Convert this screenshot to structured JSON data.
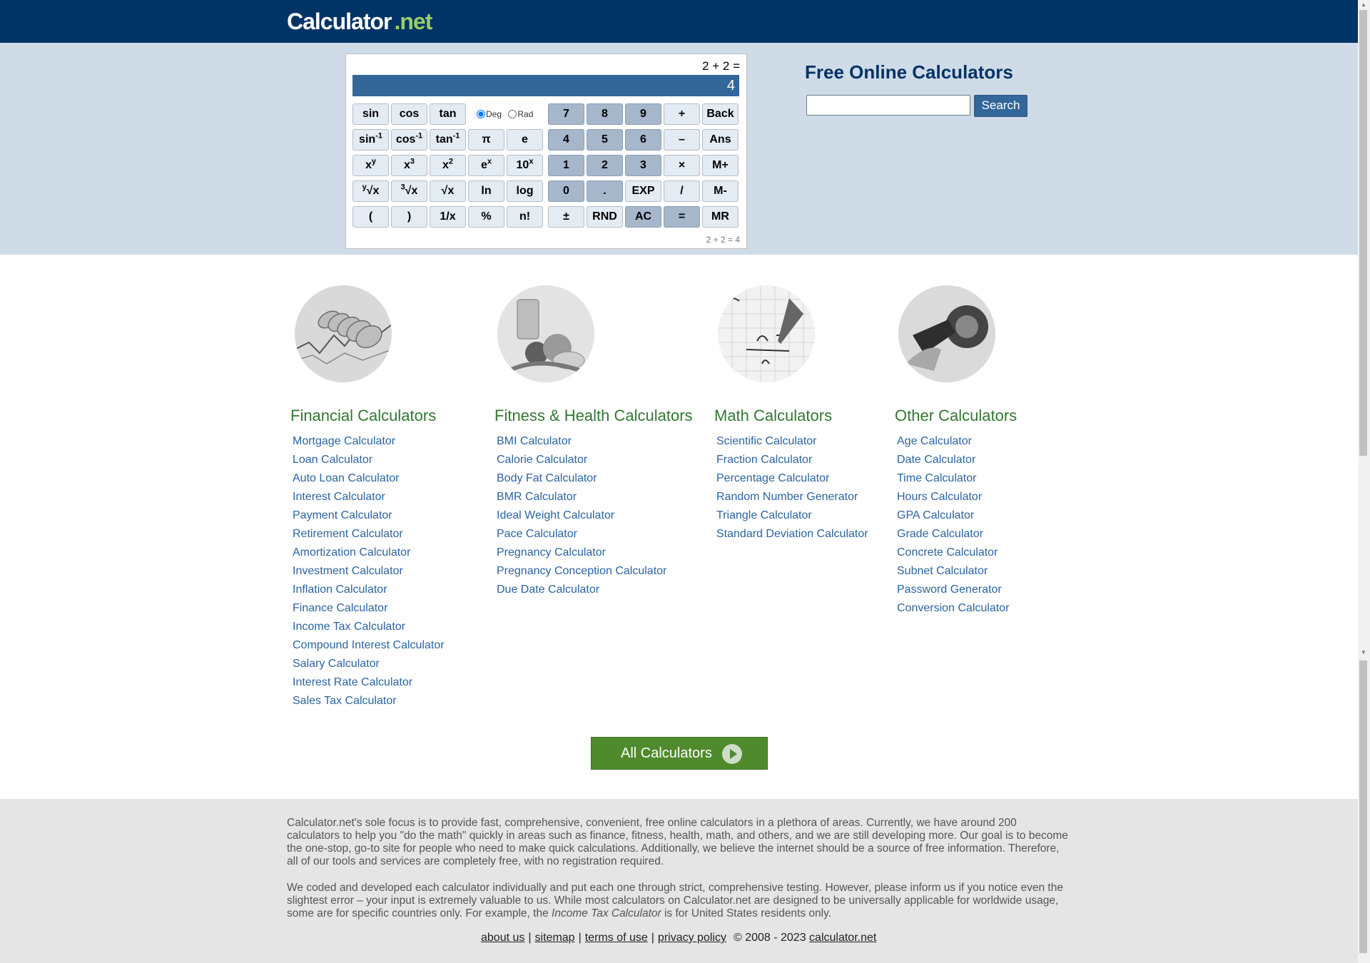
{
  "header": {
    "logo_main": "Calculator",
    "logo_tld": ".net"
  },
  "calculator": {
    "expression": "2 + 2 =",
    "display": "4",
    "footer_expression": "2 + 2 = 4",
    "angle_mode": {
      "deg": "Deg",
      "rad": "Rad",
      "selected": "Deg"
    },
    "keys": {
      "sin": "sin",
      "cos": "cos",
      "tan": "tan",
      "asin_base": "sin",
      "acos_base": "cos",
      "atan_base": "tan",
      "inverse_sup": "-1",
      "pi": "π",
      "e": "e",
      "xy_base": "x",
      "xy_sup": "y",
      "x3_base": "x",
      "x3_sup": "3",
      "x2_base": "x",
      "x2_sup": "2",
      "ex_base": "e",
      "ex_sup": "x",
      "tenx_base": "10",
      "tenx_sup": "x",
      "yroot_sup": "y",
      "yroot": "√x",
      "cuberoot_sup": "3",
      "cuberoot": "√x",
      "sqrt": "√x",
      "ln": "ln",
      "log": "log",
      "lparen": "(",
      "rparen": ")",
      "inv": "1/x",
      "percent": "%",
      "fact": "n!",
      "n7": "7",
      "n8": "8",
      "n9": "9",
      "plus": "+",
      "back": "Back",
      "n4": "4",
      "n5": "5",
      "n6": "6",
      "minus": "–",
      "ans": "Ans",
      "n1": "1",
      "n2": "2",
      "n3": "3",
      "times": "×",
      "mplus": "M+",
      "n0": "0",
      "dot": ".",
      "exp": "EXP",
      "divide": "/",
      "mminus": "M-",
      "plusminus": "±",
      "rnd": "RND",
      "ac": "AC",
      "equals": "=",
      "mr": "MR"
    }
  },
  "sidebar": {
    "title": "Free Online Calculators",
    "search_value": "",
    "search_button": "Search"
  },
  "categories": [
    {
      "title": "Financial Calculators",
      "icon": "coins-chart-image",
      "links": [
        "Mortgage Calculator",
        "Loan Calculator",
        "Auto Loan Calculator",
        "Interest Calculator",
        "Payment Calculator",
        "Retirement Calculator",
        "Amortization Calculator",
        "Investment Calculator",
        "Inflation Calculator",
        "Finance Calculator",
        "Income Tax Calculator",
        "Compound Interest Calculator",
        "Salary Calculator",
        "Interest Rate Calculator",
        "Sales Tax Calculator"
      ]
    },
    {
      "title": "Fitness & Health Calculators",
      "icon": "fruit-measuring-tape-image",
      "links": [
        "BMI Calculator",
        "Calorie Calculator",
        "Body Fat Calculator",
        "BMR Calculator",
        "Ideal Weight Calculator",
        "Pace Calculator",
        "Pregnancy Calculator",
        "Pregnancy Conception Calculator",
        "Due Date Calculator"
      ]
    },
    {
      "title": "Math Calculators",
      "icon": "math-formula-image",
      "links": [
        "Scientific Calculator",
        "Fraction Calculator",
        "Percentage Calculator",
        "Random Number Generator",
        "Triangle Calculator",
        "Standard Deviation Calculator"
      ]
    },
    {
      "title": "Other Calculators",
      "icon": "fuel-pump-image",
      "links": [
        "Age Calculator",
        "Date Calculator",
        "Time Calculator",
        "Hours Calculator",
        "GPA Calculator",
        "Grade Calculator",
        "Concrete Calculator",
        "Subnet Calculator",
        "Password Generator",
        "Conversion Calculator"
      ]
    }
  ],
  "all_calculators_button": "All Calculators",
  "footer": {
    "paragraph1": "Calculator.net's sole focus is to provide fast, comprehensive, convenient, free online calculators in a plethora of areas. Currently, we have around 200 calculators to help you \"do the math\" quickly in areas such as finance, fitness, health, math, and others, and we are still developing more. Our goal is to become the one-stop, go-to site for people who need to make quick calculations. Additionally, we believe the internet should be a source of free information. Therefore, all of our tools and services are completely free, with no registration required.",
    "paragraph2_before": "We coded and developed each calculator individually and put each one through strict, comprehensive testing. However, please inform us if you notice even the slightest error – your input is extremely valuable to us. While most calculators on Calculator.net are designed to be universally applicable for worldwide usage, some are for specific countries only. For example, the ",
    "paragraph2_em": "Income Tax Calculator",
    "paragraph2_after": " is for United States residents only.",
    "links": {
      "about": "about us",
      "sitemap": "sitemap",
      "terms": "terms of use",
      "privacy": "privacy policy"
    },
    "separator": "|",
    "copyright": "© 2008 - 2023",
    "site_link": "calculator.net"
  },
  "colors": {
    "header_bg": "#003366",
    "hero_bg": "#d0dbe8",
    "display_bg": "#336699",
    "category_title": "#337733",
    "link": "#2b64a0",
    "all_button": "#4f8a2d",
    "footer_bg": "#e5e5e5"
  }
}
